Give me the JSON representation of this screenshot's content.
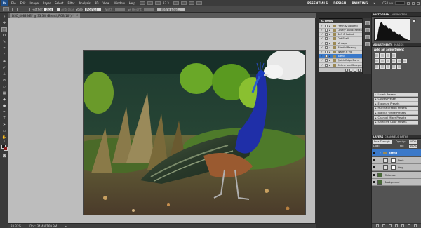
{
  "menubar": {
    "logo": "Ps",
    "items": [
      "File",
      "Edit",
      "Image",
      "Layer",
      "Select",
      "Filter",
      "Analysis",
      "3D",
      "View",
      "Window",
      "Help"
    ],
    "zoom": "33.3",
    "workspaces": [
      "ESSENTIALS",
      "DESIGN",
      "PAINTING"
    ],
    "cs_live": "CS Live"
  },
  "options": {
    "feather_label": "Feather:",
    "feather_value": "0 px",
    "antialias_label": "Anti-alias",
    "style_label": "Style:",
    "style_value": "Normal",
    "width_label": "Width:",
    "height_label": "Height:",
    "refine_edge": "Refine Edge..."
  },
  "document": {
    "tab_title": "DSC_4083.NEF @ 33.3% (Brend, RGB/16*) *",
    "zoom_status": "33.33%",
    "doc_size": "Doc: 34.4M/169.9M"
  },
  "actions": {
    "tab": "ACTIONS",
    "items": [
      {
        "label": "Fresh & Colorful",
        "checked": true,
        "selected": false
      },
      {
        "label": "Lovely And Ethereal",
        "checked": true,
        "selected": false
      },
      {
        "label": "Soft & Faded",
        "checked": true,
        "selected": false
      },
      {
        "label": "Old Shell",
        "checked": true,
        "selected": false
      },
      {
        "label": "Vintage",
        "checked": true,
        "selected": false
      },
      {
        "label": "Blissful Beauty",
        "checked": true,
        "selected": false
      },
      {
        "label": "Warm & Vic",
        "checked": true,
        "selected": false
      },
      {
        "label": "Brend",
        "checked": true,
        "selected": true
      },
      {
        "label": "Quick Edge Burn",
        "checked": true,
        "selected": false
      },
      {
        "label": "Define and Sharpen",
        "checked": true,
        "selected": false
      }
    ]
  },
  "histogram": {
    "tabs": [
      "HISTOGRAM",
      "NAVIGATOR"
    ]
  },
  "adjustments": {
    "tabs": [
      "ADJUSTMENTS",
      "MASKS"
    ],
    "title": "Add an adjustment",
    "presets": [
      "Levels Presets",
      "Curves Presets",
      "Exposure Presets",
      "Hue/Saturation Presets",
      "Black & White Presets",
      "Channel Mixer Presets",
      "Selective Color Presets"
    ]
  },
  "layers": {
    "tabs": [
      "LAYERS",
      "CHANNELS",
      "PATHS"
    ],
    "blend_mode": "Pass Through",
    "opacity_label": "Opacity:",
    "opacity": "100%",
    "lock_label": "Lock:",
    "fill_label": "Fill:",
    "fill": "100%",
    "items": [
      {
        "name": "Brend",
        "selected": true,
        "type": "group"
      },
      {
        "name": "Dark",
        "selected": false,
        "type": "adjustment"
      },
      {
        "name": "Orig",
        "selected": false,
        "type": "adjustment"
      },
      {
        "name": "Chiprose",
        "selected": false,
        "type": "pixel"
      },
      {
        "name": "Background",
        "selected": false,
        "type": "pixel"
      }
    ]
  },
  "colors": {
    "foreground": "#1a1a1a",
    "background": "#8a1a1a",
    "selection": "#3b79c9"
  }
}
